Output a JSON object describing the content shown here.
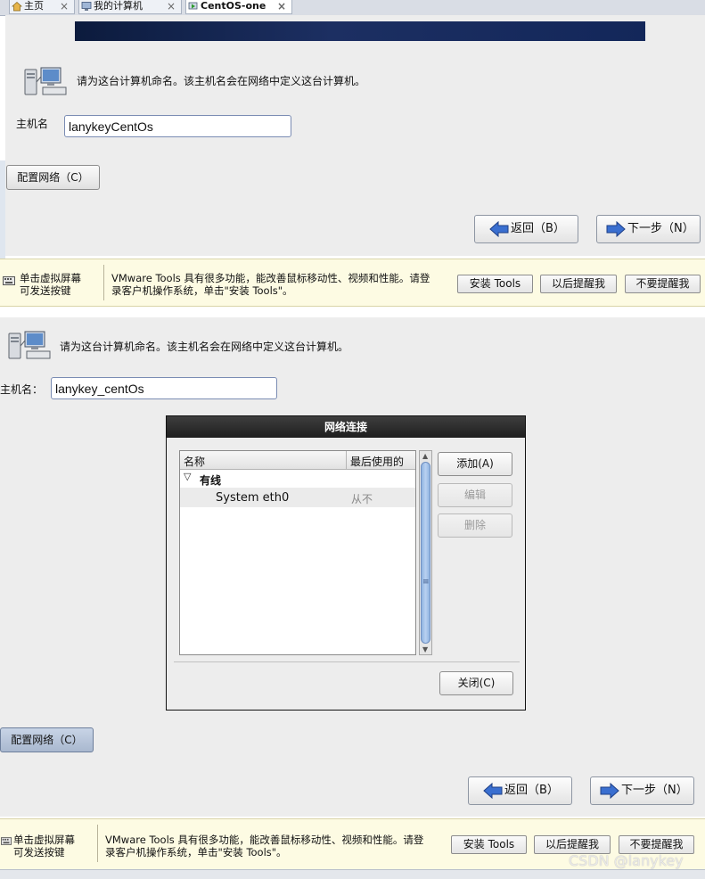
{
  "tabs": [
    {
      "label": "主页",
      "icon": "home-icon",
      "active": false
    },
    {
      "label": "我的计算机",
      "icon": "computer-icon",
      "active": false
    },
    {
      "label": "CentOS-one",
      "icon": "vm-running-icon",
      "active": true
    }
  ],
  "screen1": {
    "description": "请为这台计算机命名。该主机名会在网络中定义这台计算机。",
    "hostname_label": "主机名",
    "hostname_value": "lanykeyCentOs",
    "configure_network": "配置网络（C）",
    "back": "返回（B）",
    "next": "下一步（N）"
  },
  "vmware_bar_1": {
    "left_line1": "单击虚拟屏幕",
    "left_line2": "可发送按键",
    "msg_line1": "VMware Tools 具有很多功能，能改善鼠标移动性、视频和性能。请登",
    "msg_line2": "录客户机操作系统，单击\"安装 Tools\"。",
    "install": "安装 Tools",
    "remind_later": "以后提醒我",
    "never_remind": "不要提醒我"
  },
  "screen2": {
    "description": "请为这台计算机命名。该主机名会在网络中定义这台计算机。",
    "hostname_label": "主机名：",
    "hostname_value": "lanykey_centOs",
    "configure_network": "配置网络（C）",
    "back": "返回（B）",
    "next": "下一步（N）"
  },
  "dialog": {
    "title": "网络连接",
    "columns": [
      "名称",
      "最后使用的"
    ],
    "group": "有线",
    "connection": {
      "name": "System eth0",
      "last_used": "从不"
    },
    "add": "添加(A)",
    "edit": "编辑",
    "delete": "删除",
    "close": "关闭(C)"
  },
  "vmware_bar_2": {
    "left_line1": "单击虚拟屏幕",
    "left_line2": "可发送按键",
    "msg_line1": "VMware Tools 具有很多功能，能改善鼠标移动性、视频和性能。请登",
    "msg_line2": "录客户机操作系统，单击\"安装 Tools\"。",
    "install": "安装 Tools",
    "remind_later": "以后提醒我",
    "never_remind": "不要提醒我"
  },
  "watermark": "CSDN @lanykey",
  "colors": {
    "banner": "#13275a",
    "accent_blue": "#3a6fd0",
    "vmbar": "#fdfbe3"
  }
}
